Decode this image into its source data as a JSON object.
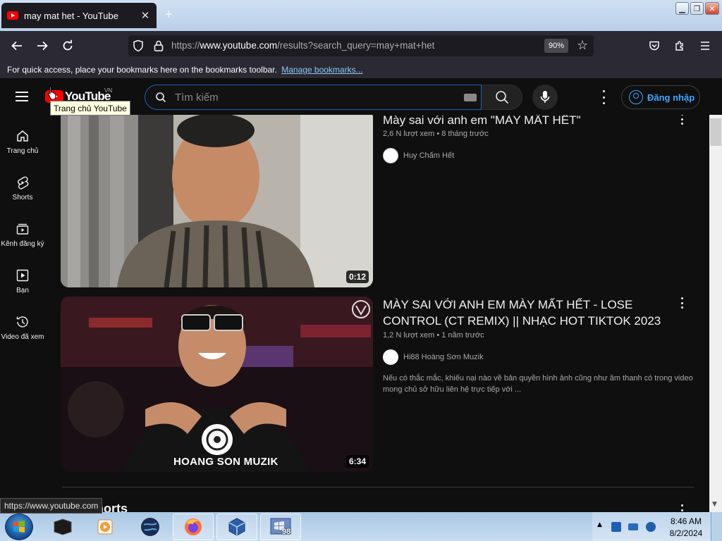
{
  "browser": {
    "tab_title": "may mat het - YouTube",
    "tab_close": "✕",
    "new_tab": "+",
    "url_prefix": "https://",
    "url_host": "www.youtube.com",
    "url_path": "/results?search_query=may+mat+het",
    "zoom": "90%",
    "bookmarks_text": "For quick access, place your bookmarks here on the bookmarks toolbar.",
    "bookmarks_link": "Manage bookmarks...",
    "status_url": "https://www.youtube.com"
  },
  "youtube": {
    "logo_text": "YouTube",
    "region": "VN",
    "logo_tooltip": "Trang chủ YouTube",
    "search_placeholder": "Tìm kiếm",
    "sign_in": "Đăng nhập",
    "brand_color": "#ff0000",
    "accent_color": "#3ea6ff"
  },
  "sidebar": {
    "items": [
      {
        "label": "Trang chủ",
        "icon": "home-icon"
      },
      {
        "label": "Shorts",
        "icon": "shorts-icon"
      },
      {
        "label": "Kênh đăng ký",
        "icon": "subscriptions-icon"
      },
      {
        "label": "Bạn",
        "icon": "you-icon"
      },
      {
        "label": "Video đã xem",
        "icon": "history-icon"
      }
    ]
  },
  "results": [
    {
      "title": "Mày sai với anh em \"MÀY MẤT HẾT\"",
      "views": "2,6 N lượt xem",
      "age": "8 tháng trước",
      "channel": "Huy Chấm Hết",
      "duration": "0:12",
      "description": ""
    },
    {
      "title": "MÀY SAI VỚI ANH EM MÀY MẤT HẾT - LOSE CONTROL (CT REMIX) || NHẠC HOT TIKTOK 2023",
      "views": "1,2 N lượt xem",
      "age": "1 năm trước",
      "channel": "Hi88 Hoàng Sơn Muzik",
      "duration": "6:34",
      "description": "Nếu có thắc mắc, khiếu nại nào về bản quyền hình ảnh cũng như âm thanh có trong video mong chủ sở hữu liên hệ trực tiếp với ...",
      "thumb_overlay": "HOANG SON MUZIK"
    }
  ],
  "shorts_heading": "Shorts",
  "meta_separator": "•",
  "taskbar": {
    "time": "8:46 AM",
    "date": "8/2/2024",
    "badge": "98"
  }
}
